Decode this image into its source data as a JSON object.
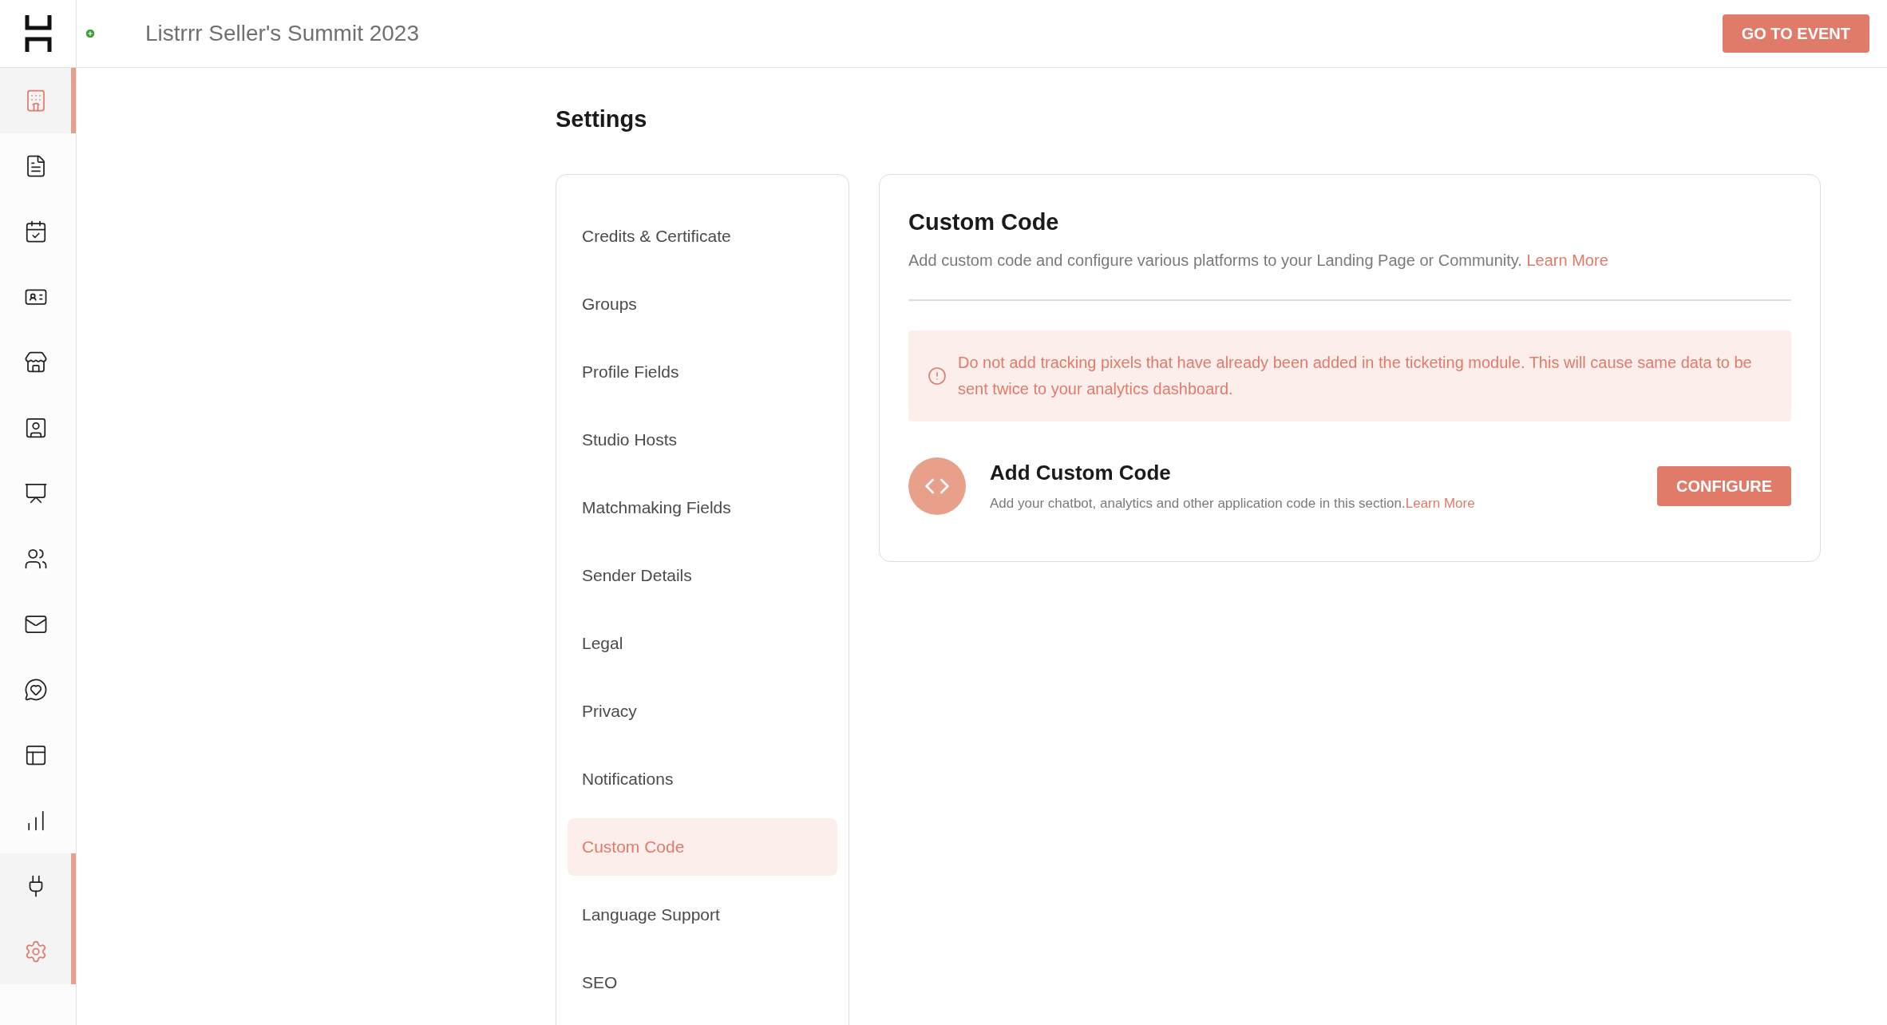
{
  "header": {
    "title": "Listrrr Seller's Summit 2023",
    "button": "GO TO EVENT"
  },
  "sidebar": {
    "items": [
      {
        "selected": true,
        "active": true
      },
      {
        "selected": false,
        "active": false
      },
      {
        "selected": false,
        "active": false
      },
      {
        "selected": false,
        "active": false
      },
      {
        "selected": false,
        "active": false
      },
      {
        "selected": false,
        "active": false
      },
      {
        "selected": false,
        "active": false
      },
      {
        "selected": false,
        "active": false
      },
      {
        "selected": false,
        "active": false
      },
      {
        "selected": false,
        "active": false
      },
      {
        "selected": false,
        "active": false
      },
      {
        "selected": false,
        "active": false
      },
      {
        "selected": true,
        "active": false
      },
      {
        "selected": true,
        "active": true
      }
    ]
  },
  "page_title": "Settings",
  "settings_menu": [
    {
      "label": "Credits & Certificate",
      "selected": false
    },
    {
      "label": "Groups",
      "selected": false
    },
    {
      "label": "Profile Fields",
      "selected": false
    },
    {
      "label": "Studio Hosts",
      "selected": false
    },
    {
      "label": "Matchmaking Fields",
      "selected": false
    },
    {
      "label": "Sender Details",
      "selected": false
    },
    {
      "label": "Legal",
      "selected": false
    },
    {
      "label": "Privacy",
      "selected": false
    },
    {
      "label": "Notifications",
      "selected": false
    },
    {
      "label": "Custom Code",
      "selected": true
    },
    {
      "label": "Language Support",
      "selected": false
    },
    {
      "label": "SEO",
      "selected": false
    }
  ],
  "panel": {
    "title": "Custom Code",
    "description": "Add custom code and configure various platforms to your Landing Page or Community.",
    "description_link": "Learn More",
    "alert": "Do not add tracking pixels that have already been added in the ticketing module. This will cause same data to be sent twice to your analytics dashboard.",
    "item": {
      "title": "Add Custom Code",
      "description": "Add your chatbot, analytics and other application code in this section.",
      "link": "Learn More",
      "button": "CONFIGURE"
    }
  }
}
